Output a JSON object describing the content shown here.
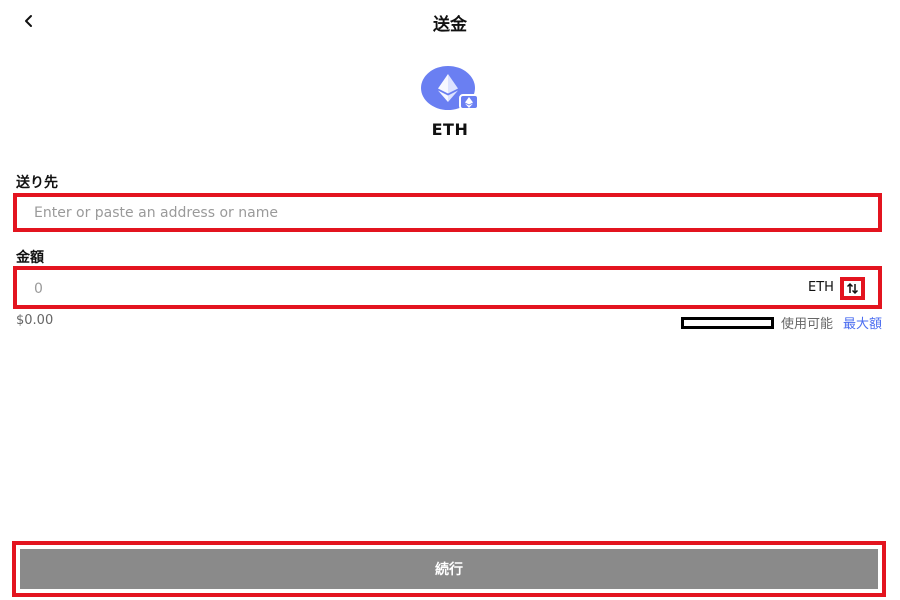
{
  "header": {
    "title": "送金",
    "back_icon": "chevron-left-icon"
  },
  "token": {
    "symbol": "ETH",
    "logo_icon": "ethereum-icon",
    "network_badge_icon": "ethereum-network-icon",
    "logo_color": "#6a7ff2"
  },
  "recipient": {
    "label": "送り先",
    "value": "",
    "placeholder": "Enter or paste an address or name"
  },
  "amount": {
    "label": "金額",
    "value": "",
    "placeholder": "0",
    "unit": "ETH",
    "swap_icon": "swap-vertical-icon",
    "fiat_value": "$0.00"
  },
  "balance": {
    "available_label": "使用可能",
    "max_label": "最大額"
  },
  "actions": {
    "continue_label": "続行"
  },
  "colors": {
    "highlight_frame": "#e3141f",
    "link": "#4a6cf0",
    "button_disabled": "#8a8a8a"
  }
}
